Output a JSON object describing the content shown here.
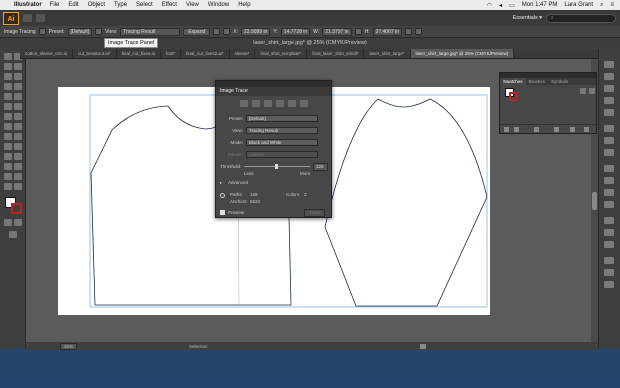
{
  "menubar": {
    "app_name": "Illustrator",
    "items": [
      "File",
      "Edit",
      "Object",
      "Type",
      "Select",
      "Effect",
      "View",
      "Window",
      "Help"
    ],
    "clock": "Mon 1:47 PM",
    "user": "Lara Grant"
  },
  "appbar": {
    "logo": "Ai",
    "workspace": "Essentials ▾"
  },
  "controlbar": {
    "mode_label": "Image Tracing",
    "preset_label": "Preset:",
    "preset_value": "[Default]",
    "view_label": "View:",
    "view_value": "Tracing Result",
    "expand_label": "Expand",
    "x_value": "23.9099 in",
    "y_value": "14.7728 in",
    "w_value": "21.3797 in",
    "h_value": "27.4067 in"
  },
  "tooltip": "Image Trace Panel",
  "document": {
    "title": "laser_shirt_large.jpg* @ 25% (CMYK/Preview)"
  },
  "tabs": [
    {
      "label": "cotton_sleeve_circ.ai"
    },
    {
      "label": "cut_breakout.ai*"
    },
    {
      "label": "final_cut_fixes.ai"
    },
    {
      "label": "font*"
    },
    {
      "label": "final_cut_fixes2.ai*"
    },
    {
      "label": "sleeve*"
    },
    {
      "label": "final_shirt_template*"
    },
    {
      "label": "final_laser_shirt_small*"
    },
    {
      "label": "laser_shirt_large*"
    },
    {
      "label": "laser_shirt_large.jpg* @ 25% (CMYK/Preview)"
    }
  ],
  "image_trace": {
    "title": "Image Trace",
    "preset_label": "Preset:",
    "preset_value": "[Default]",
    "view_label": "View:",
    "view_value": "Tracing Result",
    "mode_label": "Mode:",
    "mode_value": "Black and White",
    "palette_label": "Palette:",
    "palette_value": "Limited",
    "threshold_label": "Threshold:",
    "threshold_value": "128",
    "less_label": "Less",
    "more_label": "More",
    "advanced_label": "Advanced",
    "paths_label": "Paths:",
    "paths_value": "158",
    "colors_label": "Colors:",
    "colors_value": "2",
    "anchors_label": "Anchors:",
    "anchors_value": "5534",
    "preview_label": "Preview",
    "trace_button": "Trace"
  },
  "swatches": {
    "tabs": [
      "Swatches",
      "Brushes",
      "Symbols"
    ]
  },
  "statusbar": {
    "zoom": "25%",
    "tool": "Selection"
  },
  "colors": {
    "accent": "#f5a32a",
    "canvas": "#5b5b5b",
    "panel": "#474747"
  }
}
